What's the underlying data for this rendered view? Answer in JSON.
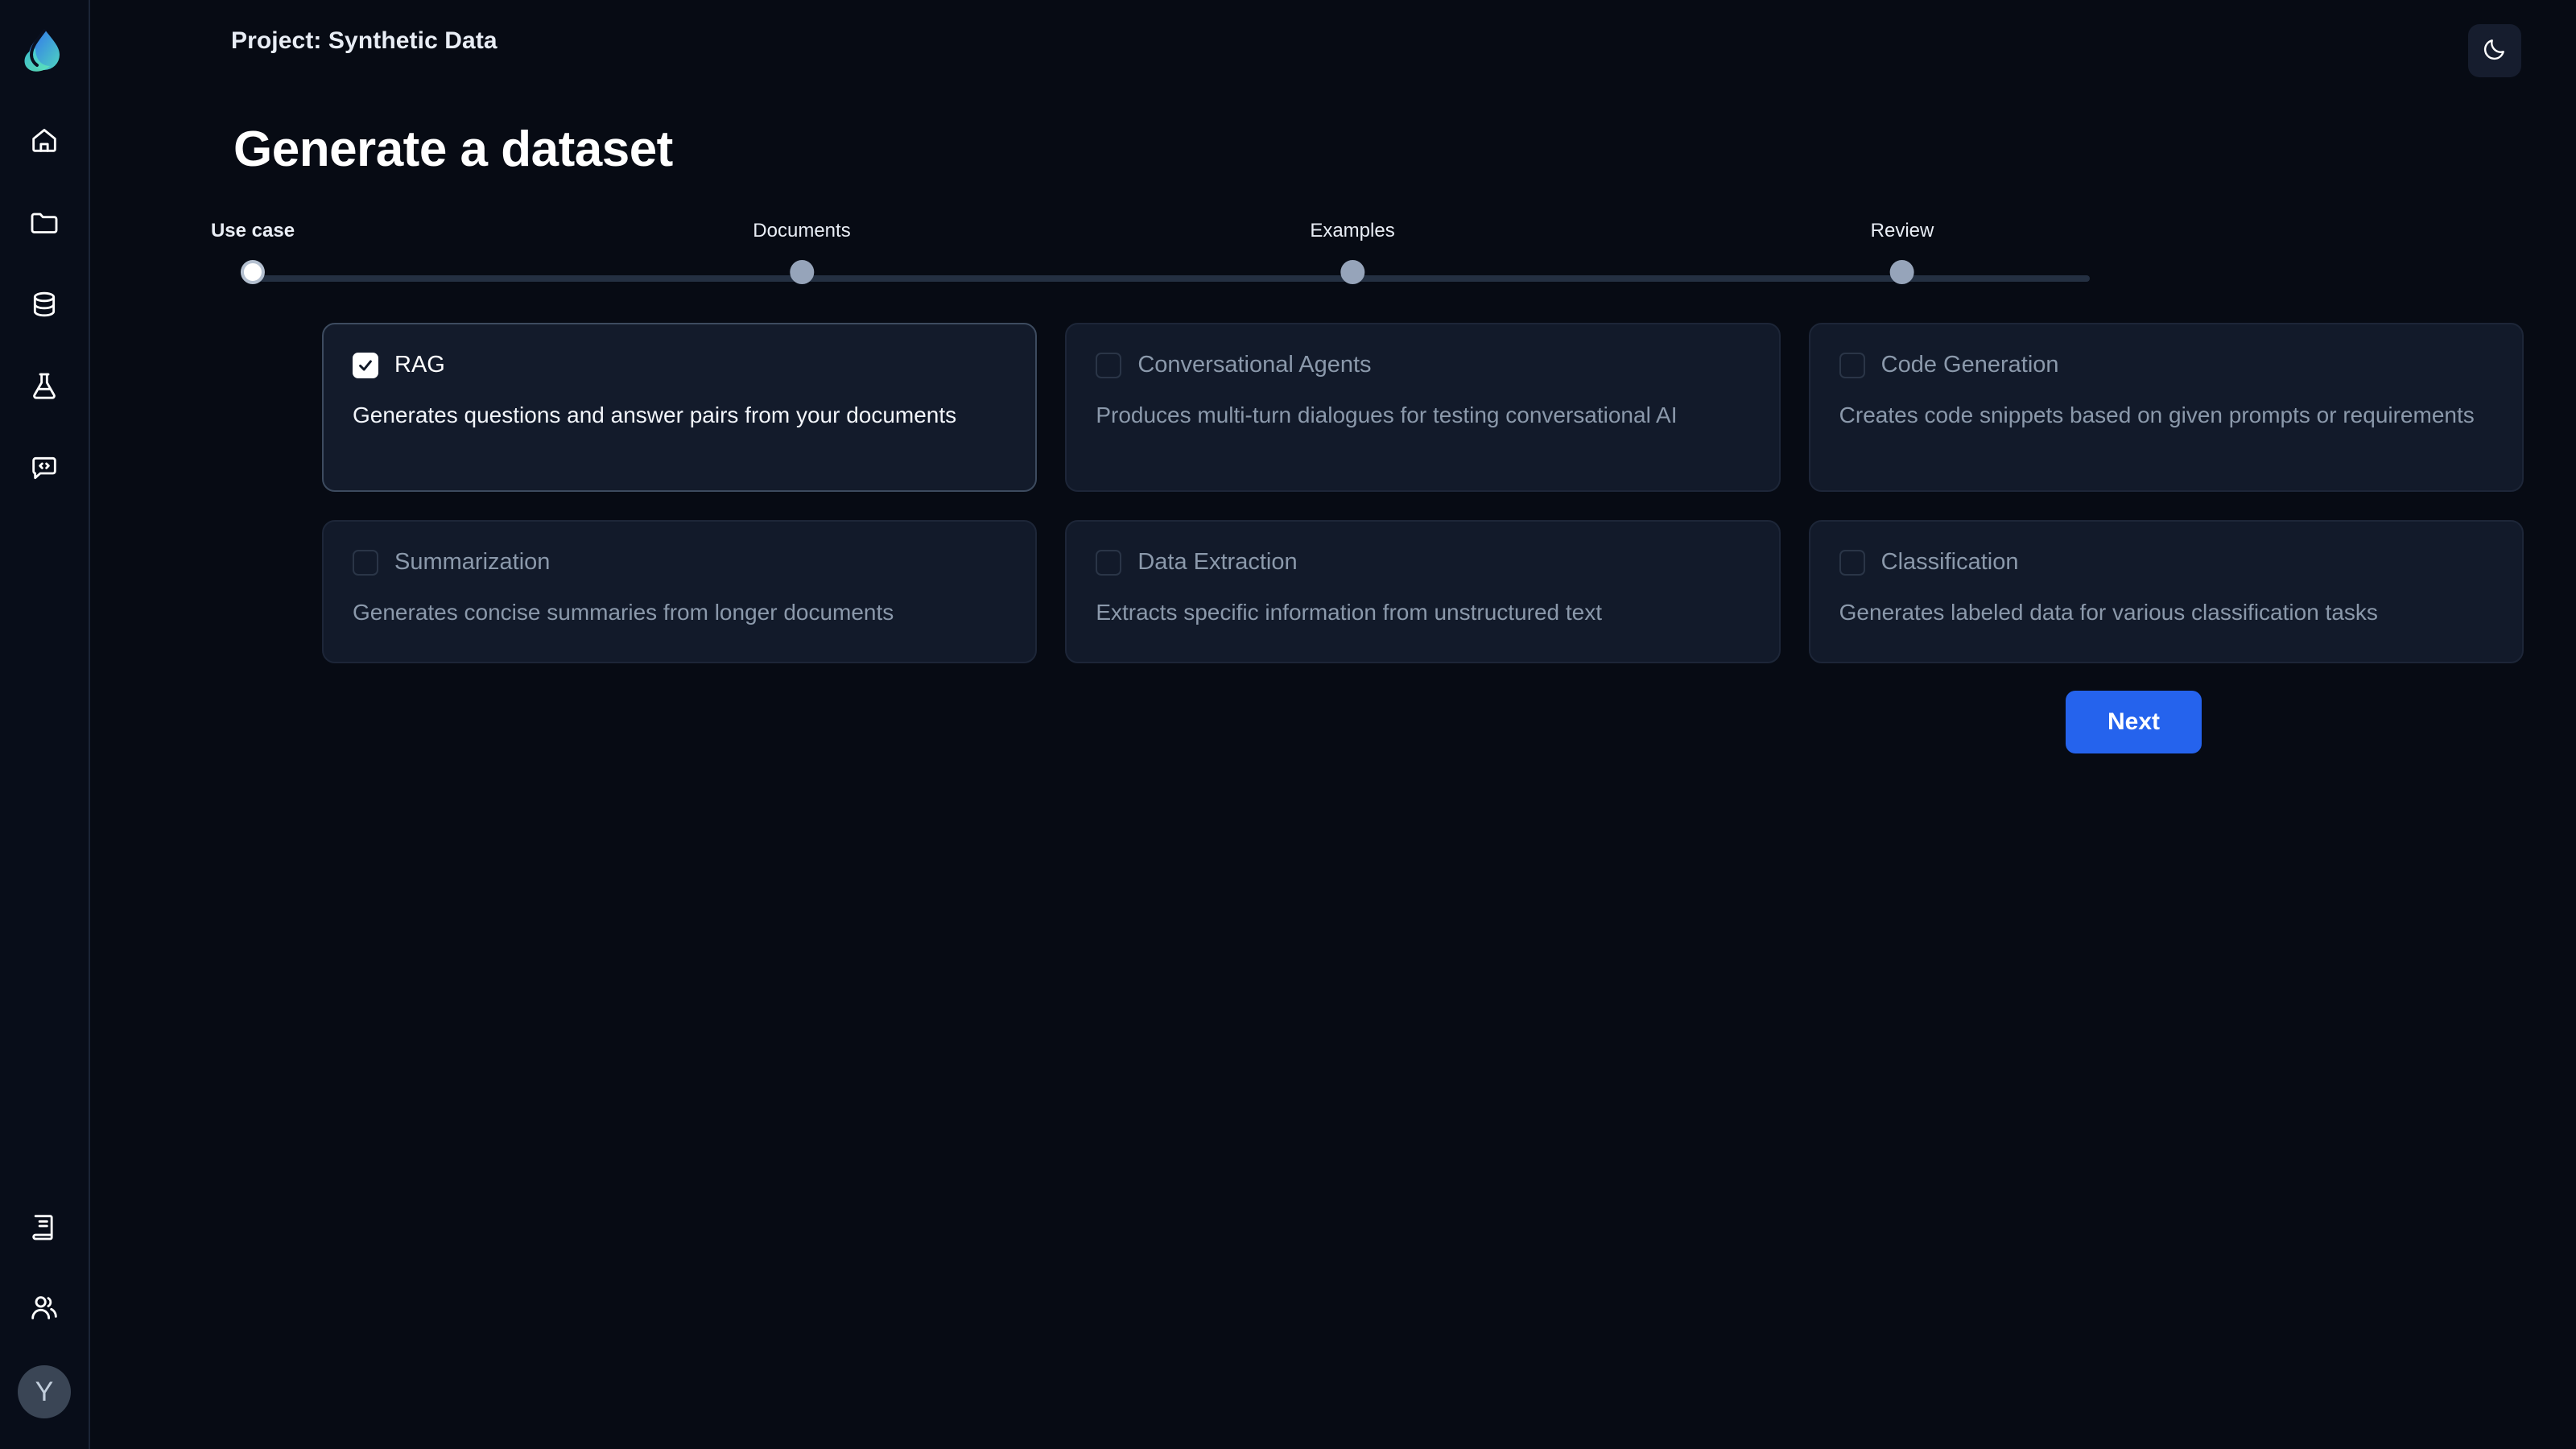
{
  "app": {
    "logo_icon": "droplet-leaf-logo",
    "accent_color": "#2563ed",
    "background_color": "#070b14",
    "card_background": "#121a2a"
  },
  "sidebar": {
    "top_items": [
      {
        "icon": "home-icon",
        "name": "sidebar-item-home"
      },
      {
        "icon": "folder-icon",
        "name": "sidebar-item-projects"
      },
      {
        "icon": "database-icon",
        "name": "sidebar-item-datasets"
      },
      {
        "icon": "flask-icon",
        "name": "sidebar-item-experiments"
      },
      {
        "icon": "chat-code-icon",
        "name": "sidebar-item-playground"
      }
    ],
    "bottom_items": [
      {
        "icon": "book-icon",
        "name": "sidebar-item-docs"
      },
      {
        "icon": "users-icon",
        "name": "sidebar-item-team"
      }
    ],
    "avatar_initial": "Y"
  },
  "header": {
    "project_title": "Project: Synthetic Data",
    "theme_toggle_icon": "moon-icon"
  },
  "page": {
    "title": "Generate a dataset"
  },
  "stepper": {
    "steps": [
      {
        "label": "Use case",
        "active": true
      },
      {
        "label": "Documents",
        "active": false
      },
      {
        "label": "Examples",
        "active": false
      },
      {
        "label": "Review",
        "active": false
      }
    ]
  },
  "use_cases": [
    {
      "label": "RAG",
      "description": "Generates questions and answer pairs from your documents",
      "selected": true
    },
    {
      "label": "Conversational Agents",
      "description": "Produces multi-turn dialogues for testing conversational AI",
      "selected": false
    },
    {
      "label": "Code Generation",
      "description": "Creates code snippets based on given prompts or requirements",
      "selected": false
    },
    {
      "label": "Summarization",
      "description": "Generates concise summaries from longer documents",
      "selected": false
    },
    {
      "label": "Data Extraction",
      "description": "Extracts specific information from unstructured text",
      "selected": false
    },
    {
      "label": "Classification",
      "description": "Generates labeled data for various classification tasks",
      "selected": false
    }
  ],
  "actions": {
    "next_label": "Next"
  }
}
